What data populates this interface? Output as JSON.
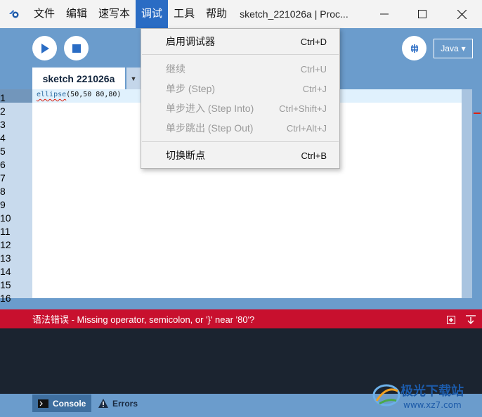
{
  "menubar": {
    "items": [
      "文件",
      "编辑",
      "速写本",
      "调试",
      "工具",
      "帮助"
    ],
    "active_index": 3,
    "window_title": "sketch_221026a | Proc..."
  },
  "toolbar": {
    "run_icon": "play-icon",
    "stop_icon": "stop-icon",
    "debug_icon": "bug-icon",
    "mode_label": "Java"
  },
  "tabs": [
    {
      "label": "sketch 221026a"
    }
  ],
  "editor": {
    "line_numbers": [
      "1",
      "2",
      "3",
      "4",
      "5",
      "6",
      "7",
      "8",
      "9",
      "10",
      "11",
      "12",
      "13",
      "14",
      "15",
      "16"
    ],
    "code_keyword": "ellipse",
    "code_args": "(50,50 80,80)"
  },
  "debug_menu": {
    "items": [
      {
        "label": "启用调试器",
        "shortcut": "Ctrl+D",
        "enabled": true
      },
      {
        "label": "继续",
        "shortcut": "Ctrl+U",
        "enabled": false
      },
      {
        "label": "单步 (Step)",
        "shortcut": "Ctrl+J",
        "enabled": false
      },
      {
        "label": "单步进入 (Step Into)",
        "shortcut": "Ctrl+Shift+J",
        "enabled": false
      },
      {
        "label": "单步跳出 (Step Out)",
        "shortcut": "Ctrl+Alt+J",
        "enabled": false
      },
      {
        "label": "切换断点",
        "shortcut": "Ctrl+B",
        "enabled": true
      }
    ]
  },
  "status": {
    "error_message": "语法错误 - Missing operator, semicolon, or '}' near '80'?"
  },
  "bottom_tabs": {
    "console": "Console",
    "errors": "Errors"
  },
  "watermark": {
    "brand": "极光下载站",
    "url": "www.xz7.com"
  },
  "colors": {
    "accent": "#2a6cc4",
    "error": "#c8102e",
    "background": "#6b9ccc",
    "console": "#1b2430"
  }
}
